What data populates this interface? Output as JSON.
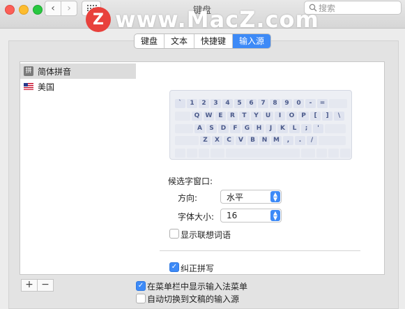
{
  "window": {
    "title": "键盘"
  },
  "search": {
    "placeholder": "搜索"
  },
  "watermark": {
    "logo": "Z",
    "text": "www.MacZ.com"
  },
  "tabs": [
    {
      "label": "键盘",
      "active": false
    },
    {
      "label": "文本",
      "active": false
    },
    {
      "label": "快捷键",
      "active": false
    },
    {
      "label": "输入源",
      "active": true
    }
  ],
  "sources": [
    {
      "icon": "拼",
      "label": "简体拼音",
      "selected": true
    },
    {
      "icon": "us-flag-icon",
      "label": "美国",
      "selected": false
    }
  ],
  "keyboard": {
    "row1": [
      "`",
      "1",
      "2",
      "3",
      "4",
      "5",
      "6",
      "7",
      "8",
      "9",
      "0",
      "-",
      "="
    ],
    "row2": [
      "Q",
      "W",
      "E",
      "R",
      "T",
      "Y",
      "U",
      "I",
      "O",
      "P",
      "[",
      "]",
      "\\"
    ],
    "row3": [
      "A",
      "S",
      "D",
      "F",
      "G",
      "H",
      "J",
      "K",
      "L",
      ";",
      "'"
    ],
    "row4": [
      "Z",
      "X",
      "C",
      "V",
      "B",
      "N",
      "M",
      ",",
      ".",
      "/"
    ]
  },
  "options": {
    "candidate_window": "候选字窗口:",
    "direction_label": "方向:",
    "direction_value": "水平",
    "font_size_label": "字体大小:",
    "font_size_value": "16",
    "show_predictive": "显示联想词语",
    "correct_pinyin": "纠正拼写"
  },
  "footer": {
    "add": "+",
    "remove": "−",
    "show_menu": "在菜单栏中显示输入法菜单",
    "auto_switch": "自动切换到文稿的输入源"
  },
  "colors": {
    "accent": "#3d8af7",
    "watermark_red": "#e8413c"
  }
}
